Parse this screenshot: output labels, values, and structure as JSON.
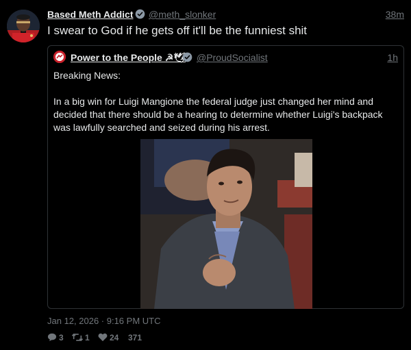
{
  "tweet": {
    "author_name": "Based Meth Addict",
    "author_handle": "@meth_slonker",
    "time_ago": "38m",
    "text": "I swear to God if he gets off it'll be the funniest shit",
    "date_line": "Jan 12, 2026 · 9:16 PM UTC",
    "stats": {
      "replies": "3",
      "retweets": "1",
      "likes": "24",
      "views": "371"
    }
  },
  "quoted": {
    "author_name": "Power to the People ☭🕊",
    "author_handle": "@ProudSocialist",
    "time_ago": "1h",
    "line1": "Breaking News:",
    "body": "In a big win for Luigi Mangione the federal judge just changed her mind and decided that there should be a hearing to determine whether Luigi's backpack was lawfully searched and seized during his arrest."
  },
  "colors": {
    "background": "#000000",
    "text": "#e7e9ea",
    "muted": "#71767b",
    "border": "#2f3336",
    "verified": "#8b98a5"
  },
  "icons": [
    "verified-badge-icon",
    "reply-icon",
    "retweet-icon",
    "like-icon"
  ]
}
